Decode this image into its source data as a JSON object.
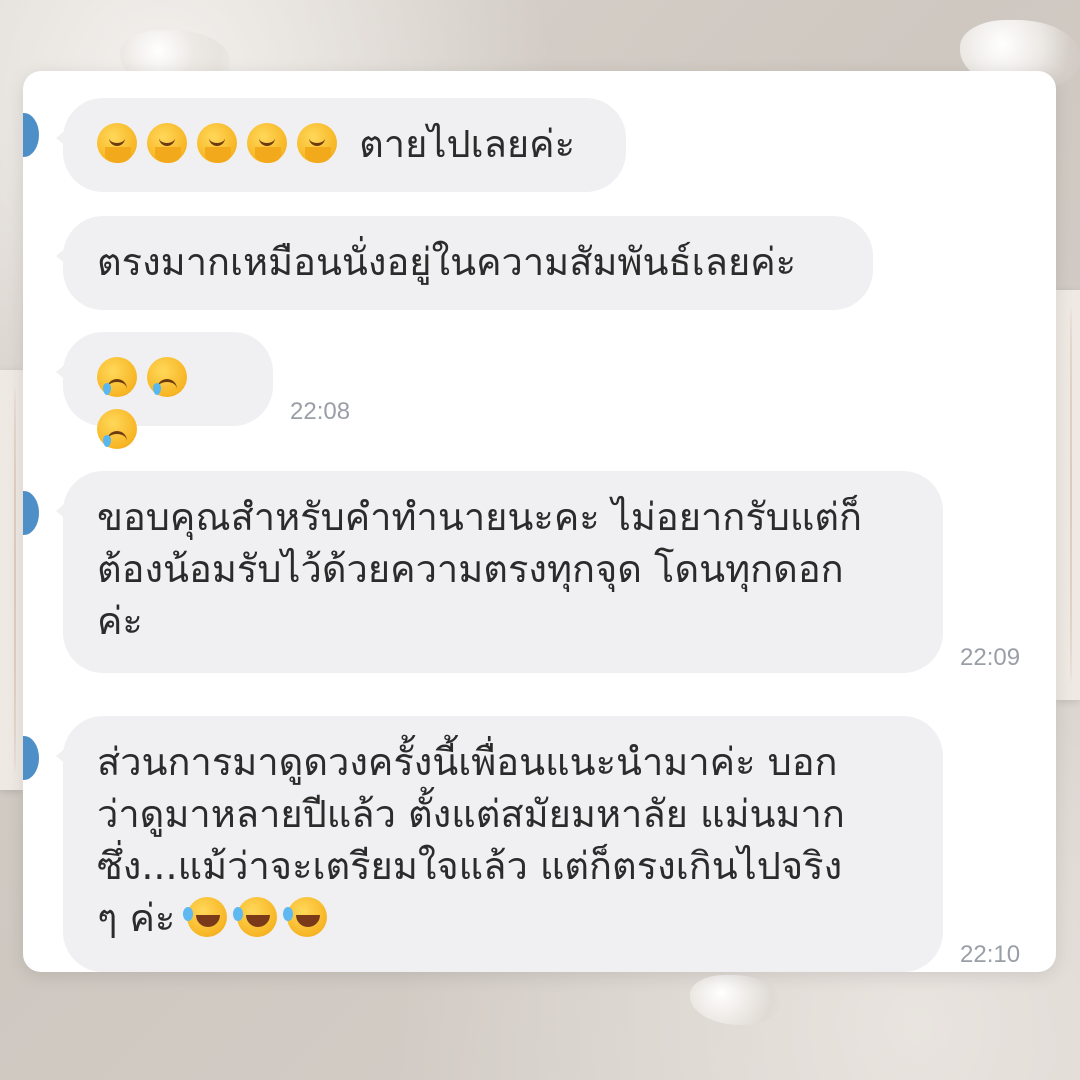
{
  "messages": [
    {
      "emoji": "melting-face",
      "emoji_count": 5,
      "text": "ตายไปเลยค่ะ",
      "time": ""
    },
    {
      "emoji": "",
      "emoji_count": 0,
      "text": "ตรงมากเหมือนนั่งอยู่ในความสัมพันธ์เลยค่ะ",
      "time": ""
    },
    {
      "emoji": "face-holding-back-tears",
      "emoji_count": 3,
      "text": "",
      "time": "22:08"
    },
    {
      "emoji": "",
      "emoji_count": 0,
      "text": "ขอบคุณสำหรับคำทำนายนะคะ ไม่อยากรับแต่ก็\nต้องน้อมรับไว้ด้วยความตรงทุกจุด โดนทุกดอก\nค่ะ",
      "time": "22:09"
    },
    {
      "emoji": "rolling-on-floor-laughing",
      "emoji_count": 3,
      "text": "ส่วนการมาดูดวงครั้งนี้เพื่อนแนะนำมาค่ะ บอก\nว่าดูมาหลายปีแล้ว ตั้งแต่สมัยมหาลัย แม่นมาก\nซึ่ง...แม้ว่าจะเตรียมใจแล้ว แต่ก็ตรงเกินไปจริง\nๆ ค่ะ",
      "time": "22:10"
    }
  ],
  "colors": {
    "bubble": "#f0f0f2",
    "avatar": "#4f8fc8",
    "timestamp": "#9a9ea6"
  }
}
